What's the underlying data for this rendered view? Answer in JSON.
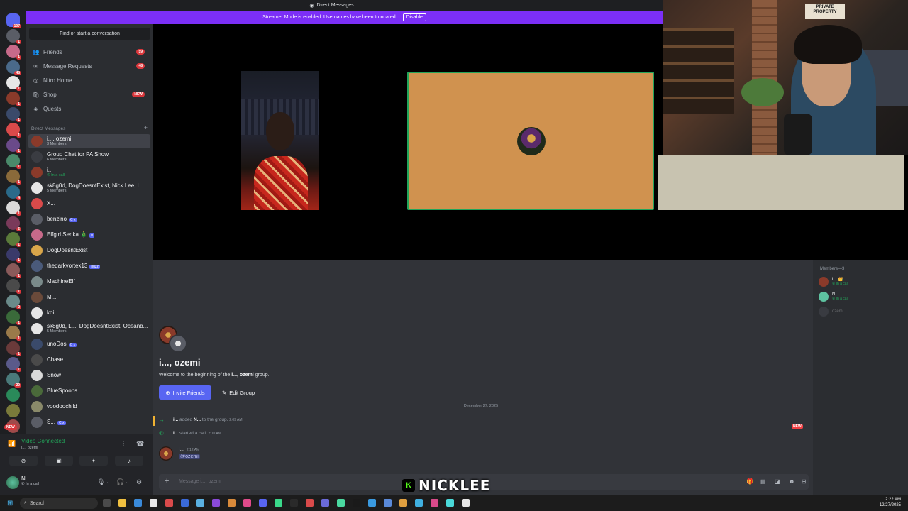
{
  "window": {
    "title": "Direct Messages"
  },
  "banner": {
    "text": "Streamer Mode is enabled. Usernames have been truncated.",
    "button": "Disable"
  },
  "guilds": {
    "home_badge": "107",
    "badges": [
      "1",
      "1",
      "48",
      "1",
      "1",
      "1",
      "1",
      "1",
      "1",
      "1",
      "4",
      "1",
      "5",
      "1",
      "1",
      "1",
      "1",
      "2",
      "1",
      "1",
      "1",
      "1",
      "20"
    ],
    "new_label": "NEW"
  },
  "sidebar": {
    "find_placeholder": "Find or start a conversation",
    "nav": [
      {
        "label": "Friends",
        "badge": "59",
        "icon": "friends-icon"
      },
      {
        "label": "Message Requests",
        "badge": "48",
        "icon": "inbox-icon"
      },
      {
        "label": "Nitro Home",
        "badge": "",
        "icon": "nitro-icon"
      },
      {
        "label": "Shop",
        "badge": "NEW",
        "icon": "shop-icon"
      },
      {
        "label": "Quests",
        "badge": "",
        "icon": "quests-icon"
      }
    ],
    "dm_header": "Direct Messages",
    "dms": [
      {
        "name": "i..., ozemi",
        "sub": "3 Members",
        "tag": "",
        "selected": true,
        "color": "#8a3a2a"
      },
      {
        "name": "Group Chat for PA Show",
        "sub": "6 Members",
        "tag": "",
        "selected": false,
        "color": "#3a3c42"
      },
      {
        "name": "i...",
        "sub": "In a call",
        "tag": "",
        "selected": false,
        "color": "#8a3a2a",
        "call": true
      },
      {
        "name": "sk8g0d, DogDoesntExist, Nick Lee, L...",
        "sub": "5 Members",
        "tag": "",
        "selected": false,
        "color": "#e6e6e6"
      },
      {
        "name": "X...",
        "sub": "",
        "tag": "",
        "selected": false,
        "color": "#d94a4a"
      },
      {
        "name": "benzino",
        "sub": "",
        "tag": "C x",
        "selected": false,
        "color": "#5a5d66"
      },
      {
        "name": "Elfgirl Serika 🎄",
        "sub": "",
        "tag": "♥",
        "selected": false,
        "color": "#c76a8a"
      },
      {
        "name": "DogDoesntExist",
        "sub": "",
        "tag": "",
        "selected": false,
        "color": "#d9a64a"
      },
      {
        "name": "thedarkvortex13",
        "sub": "",
        "tag": "buzz",
        "selected": false,
        "color": "#4a5a7a"
      },
      {
        "name": "MachineElf",
        "sub": "",
        "tag": "",
        "selected": false,
        "color": "#7a8a8a"
      },
      {
        "name": "M...",
        "sub": "",
        "tag": "",
        "selected": false,
        "color": "#6a4a3a"
      },
      {
        "name": "koi",
        "sub": "",
        "tag": "",
        "selected": false,
        "color": "#e6e6e6"
      },
      {
        "name": "sk8g0d, L..., DogDoesntExist, Oceanb...",
        "sub": "5 Members",
        "tag": "",
        "selected": false,
        "color": "#e6e6e6"
      },
      {
        "name": "unoDos",
        "sub": "",
        "tag": "C x",
        "selected": false,
        "color": "#3a4a6a"
      },
      {
        "name": "Chase",
        "sub": "",
        "tag": "",
        "selected": false,
        "color": "#4a4a4a"
      },
      {
        "name": "Snow",
        "sub": "",
        "tag": "",
        "selected": false,
        "color": "#d9d9d9"
      },
      {
        "name": "BlueSpoons",
        "sub": "",
        "tag": "",
        "selected": false,
        "color": "#4a6a3a"
      },
      {
        "name": "voodoochild",
        "sub": "",
        "tag": "",
        "selected": false,
        "color": "#8a8a6a"
      },
      {
        "name": "S...",
        "sub": "",
        "tag": "C x",
        "selected": false,
        "color": "#5a5d66"
      }
    ]
  },
  "voice": {
    "status": "Video Connected",
    "channel": "i..., ozemi"
  },
  "user": {
    "name": "N...",
    "status_icon": "phone-icon",
    "status": "In a call"
  },
  "webcam": {
    "sign": "PRIVATE PROPERTY"
  },
  "members": {
    "header": "Members—3",
    "list": [
      {
        "name": "i... 👑",
        "sub": "In a call",
        "color": "#8a3a2a"
      },
      {
        "name": "N...",
        "sub": "In a call",
        "color": "#5ec2a0"
      },
      {
        "name": "ozemi",
        "sub": "",
        "color": "#5a5d66",
        "faded": true
      }
    ]
  },
  "chat": {
    "group_title": "i..., ozemi",
    "welcome_pre": "Welcome to the beginning of the",
    "welcome_name": "i..., ozemi",
    "welcome_post": "group.",
    "invite_label": "Invite Friends",
    "edit_label": "Edit Group",
    "date": "December 27, 2025",
    "new_label": "NEW",
    "sys1": {
      "actor": "i...",
      "action": "added",
      "target": "N...",
      "tail": "to the group.",
      "time": "2:09 AM"
    },
    "sys2": {
      "actor": "i...",
      "action": "started a call.",
      "time": "2:10 AM"
    },
    "message": {
      "author": "i...",
      "time": "2:12 AM",
      "text": "@ozemi"
    },
    "composer_placeholder": "Message i..., ozemi"
  },
  "overlay": {
    "badge": "K",
    "name": "NICKLEE"
  },
  "taskbar": {
    "search": "Search",
    "time": "2:22 AM",
    "date": "12/27/2025"
  }
}
